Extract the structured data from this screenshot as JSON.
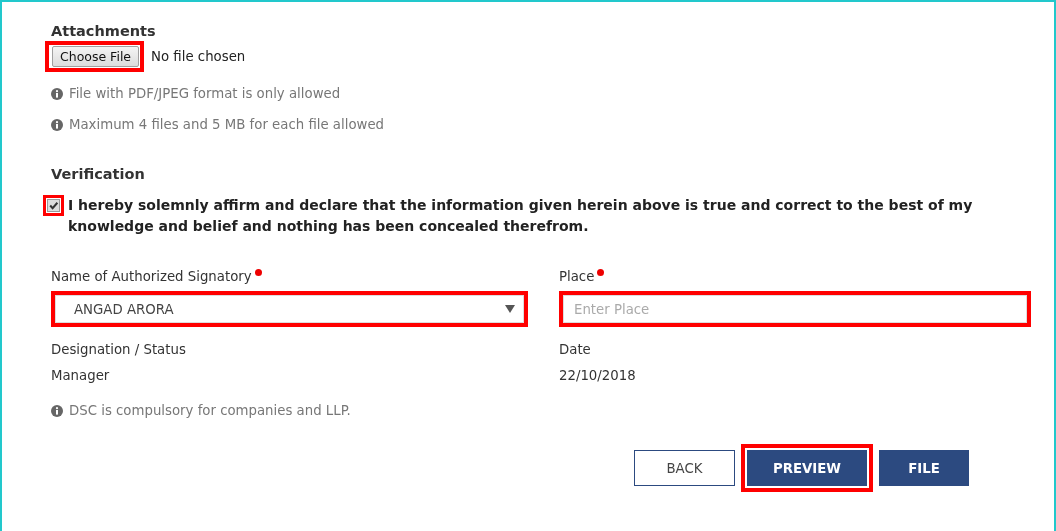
{
  "attachments": {
    "heading": "Attachments",
    "choose_button": {
      "label": "Choose File",
      "highlighted": true
    },
    "file_status": "No file chosen",
    "notes": [
      "File with PDF/JPEG format is only allowed",
      "Maximum 4 files and 5 MB for each file allowed"
    ]
  },
  "verification": {
    "heading": "Verification",
    "checkbox": {
      "checked": true,
      "highlighted": true
    },
    "declaration": "I hereby solemnly affirm and declare that the information given herein above is true and correct to the best of my knowledge and belief and nothing has been concealed therefrom."
  },
  "signatory": {
    "label": "Name of Authorized Signatory",
    "required": true,
    "value": "ANGAD ARORA",
    "highlighted": true
  },
  "place": {
    "label": "Place",
    "required": true,
    "placeholder": "Enter Place",
    "highlighted": true
  },
  "designation": {
    "label": "Designation / Status",
    "value": "Manager"
  },
  "date": {
    "label": "Date",
    "value": "22/10/2018"
  },
  "dsc_note": "DSC is compulsory for companies and LLP.",
  "buttons": [
    {
      "label": "BACK",
      "kind": "outline",
      "highlighted": false
    },
    {
      "label": "PREVIEW",
      "kind": "primary",
      "highlighted": true
    },
    {
      "label": "FILE",
      "kind": "primary",
      "highlighted": false
    }
  ]
}
